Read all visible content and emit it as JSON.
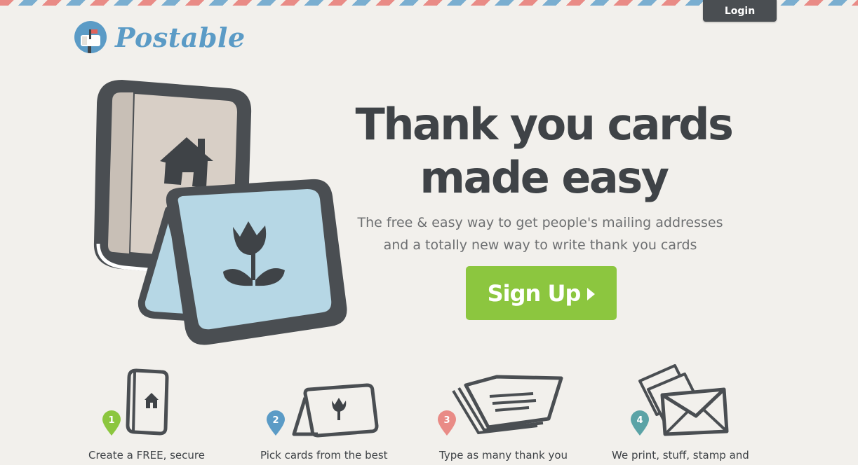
{
  "nav": {
    "login_label": "Login"
  },
  "brand": {
    "name": "Postable",
    "color": "#5b9bc6"
  },
  "hero": {
    "headline_line1": "Thank you cards",
    "headline_line2": "made easy",
    "subhead_line1": "The free & easy way to get people's mailing addresses",
    "subhead_line2": "and a totally new way to write thank you cards",
    "cta_label": "Sign Up",
    "cta_color": "#8cc63f"
  },
  "steps": [
    {
      "number": "1",
      "text": "Create a FREE, secure",
      "pin_color": "#8cc63f",
      "icon": "address-book-icon"
    },
    {
      "number": "2",
      "text": "Pick cards from the best",
      "pin_color": "#5b9bc6",
      "icon": "card-icon"
    },
    {
      "number": "3",
      "text": "Type as many thank you",
      "pin_color": "#e98b86",
      "icon": "stack-of-cards-icon"
    },
    {
      "number": "4",
      "text": "We print, stuff, stamp and",
      "pin_color": "#5ba3a6",
      "icon": "envelopes-icon"
    }
  ],
  "colors": {
    "background": "#f2f0ec",
    "dark": "#4a4e52",
    "stripe_red": "#e98b86",
    "stripe_blue": "#7aaed0"
  }
}
